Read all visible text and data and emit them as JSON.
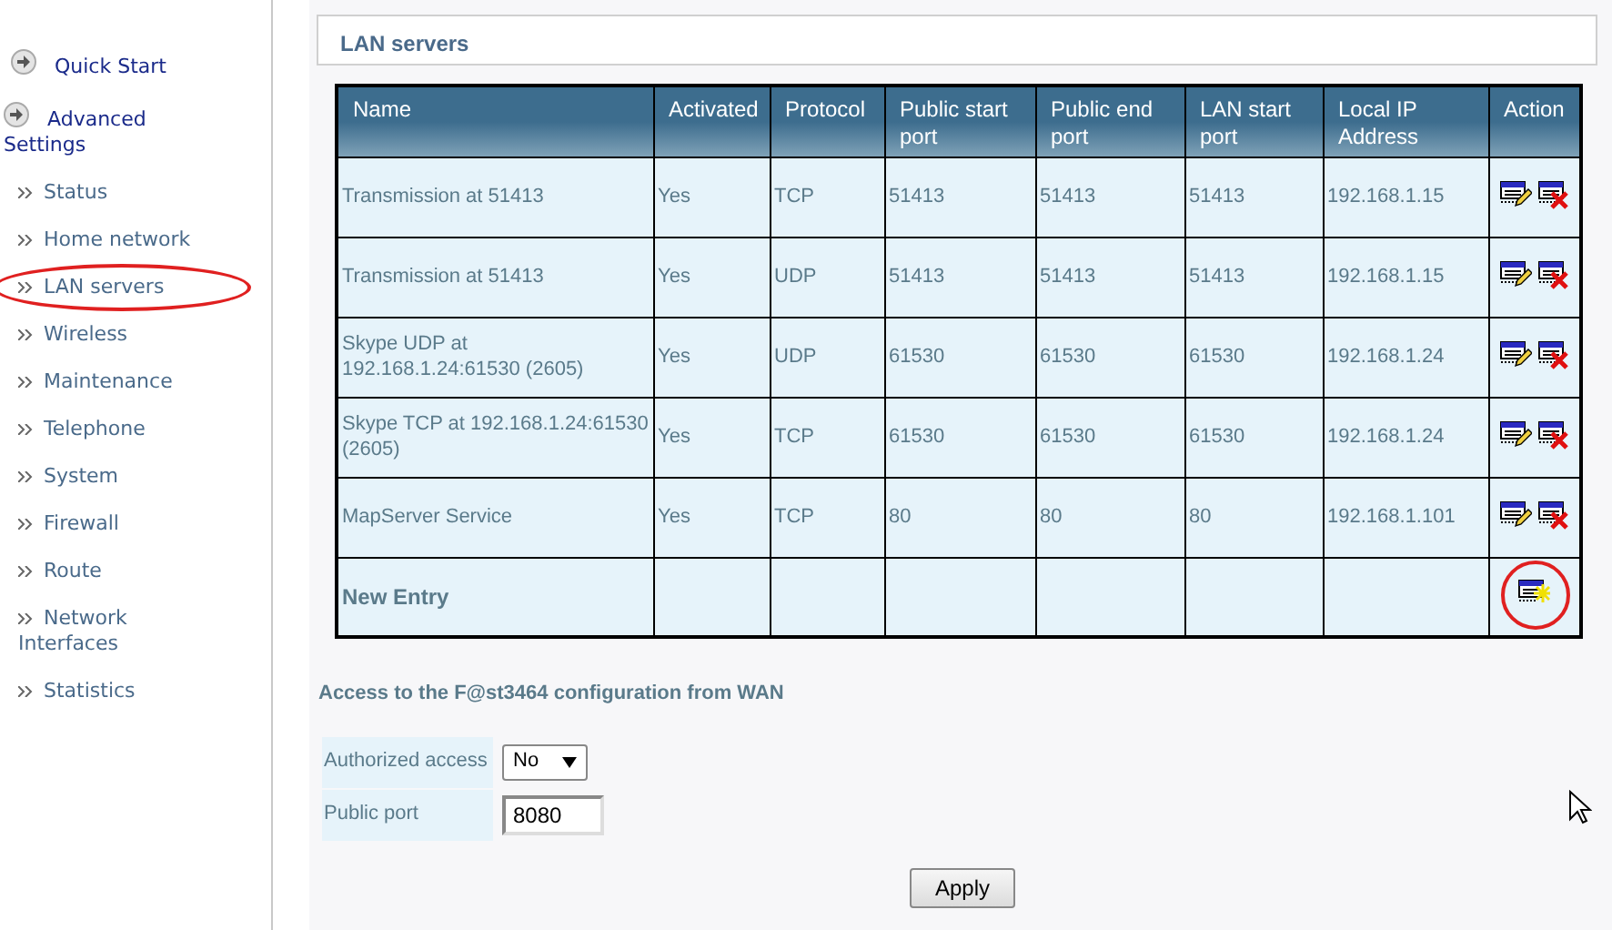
{
  "sidebar": {
    "sections": [
      {
        "label": "Quick Start"
      },
      {
        "label": "Advanced Settings"
      }
    ],
    "items": [
      {
        "label": "Status",
        "selected": false
      },
      {
        "label": "Home network",
        "selected": false
      },
      {
        "label": "LAN servers",
        "selected": true
      },
      {
        "label": "Wireless",
        "selected": false
      },
      {
        "label": "Maintenance",
        "selected": false
      },
      {
        "label": "Telephone",
        "selected": false
      },
      {
        "label": "System",
        "selected": false
      },
      {
        "label": "Firewall",
        "selected": false
      },
      {
        "label": "Route",
        "selected": false
      },
      {
        "label": "Network Interfaces",
        "selected": false
      },
      {
        "label": "Statistics",
        "selected": false
      }
    ]
  },
  "panel_title": "LAN servers",
  "table": {
    "columns": [
      "Name",
      "Activated",
      "Protocol",
      "Public start port",
      "Public end port",
      "LAN start port",
      "Local IP Address",
      "Action"
    ],
    "rows": [
      {
        "kind": "entry",
        "cells": [
          "Transmission at 51413",
          "Yes",
          "TCP",
          "51413",
          "51413",
          "51413",
          "192.168.1.15"
        ]
      },
      {
        "kind": "entry",
        "cells": [
          "Transmission at 51413",
          "Yes",
          "UDP",
          "51413",
          "51413",
          "51413",
          "192.168.1.15"
        ]
      },
      {
        "kind": "entry",
        "cells": [
          "Skype UDP at 192.168.1.24:61530 (2605)",
          "Yes",
          "UDP",
          "61530",
          "61530",
          "61530",
          "192.168.1.24"
        ]
      },
      {
        "kind": "entry",
        "cells": [
          "Skype TCP at 192.168.1.24:61530 (2605)",
          "Yes",
          "TCP",
          "61530",
          "61530",
          "61530",
          "192.168.1.24"
        ]
      },
      {
        "kind": "entry",
        "cells": [
          "MapServer Service",
          "Yes",
          "TCP",
          "80",
          "80",
          "80",
          "192.168.1.101"
        ]
      },
      {
        "kind": "new",
        "name": "New Entry",
        "highlighted": true
      }
    ]
  },
  "wan_access": {
    "title": "Access to the F@st3464 configuration from WAN",
    "fields": [
      {
        "kind": "select",
        "label": "Authorized access",
        "value": "No"
      },
      {
        "kind": "text",
        "label": "Public port",
        "value": "8080"
      }
    ],
    "button": "Apply"
  }
}
